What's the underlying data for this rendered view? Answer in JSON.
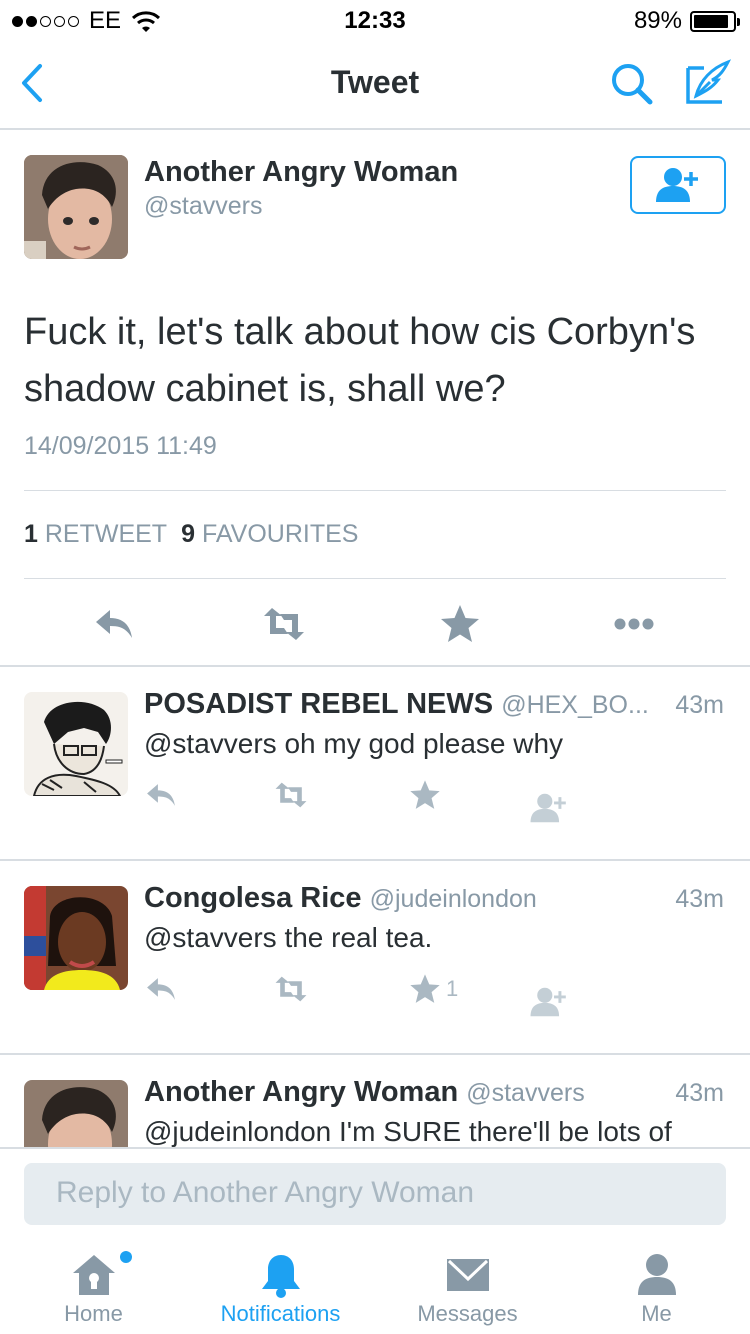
{
  "status_bar": {
    "carrier": "EE",
    "time": "12:33",
    "battery": "89%",
    "battery_level": 0.89
  },
  "nav": {
    "title": "Tweet"
  },
  "main_tweet": {
    "author_name": "Another Angry Woman",
    "author_handle": "@stavvers",
    "text": "Fuck it, let's talk about how cis Corbyn's shadow cabinet is, shall we?",
    "timestamp": "14/09/2015 11:49",
    "retweet_count": "1",
    "retweet_label": "RETWEET",
    "favourite_count": "9",
    "favourite_label": "FAVOURITES"
  },
  "replies": [
    {
      "name": "POSADIST REBEL NEWS",
      "handle": "@HEX_BO...",
      "time": "43m",
      "text": "@stavvers oh my god please why",
      "fav_count": ""
    },
    {
      "name": "Congolesa Rice",
      "handle": "@judeinlondon",
      "time": "43m",
      "text": "@stavvers the real tea.",
      "fav_count": "1"
    },
    {
      "name": "Another Angry Woman",
      "handle": "@stavvers",
      "time": "43m",
      "text": "@judeinlondon I'm SURE there'll be lots of",
      "fav_count": ""
    }
  ],
  "composer": {
    "placeholder": "Reply to Another Angry Woman"
  },
  "tabbar": {
    "items": [
      {
        "label": "Home",
        "icon": "home-icon"
      },
      {
        "label": "Notifications",
        "icon": "bell-icon"
      },
      {
        "label": "Messages",
        "icon": "envelope-icon"
      },
      {
        "label": "Me",
        "icon": "person-icon"
      }
    ],
    "active": "Notifications"
  },
  "colors": {
    "accent": "#1da1f2",
    "muted": "#8899a6",
    "text": "#292f33",
    "divider": "#d8dde2"
  }
}
